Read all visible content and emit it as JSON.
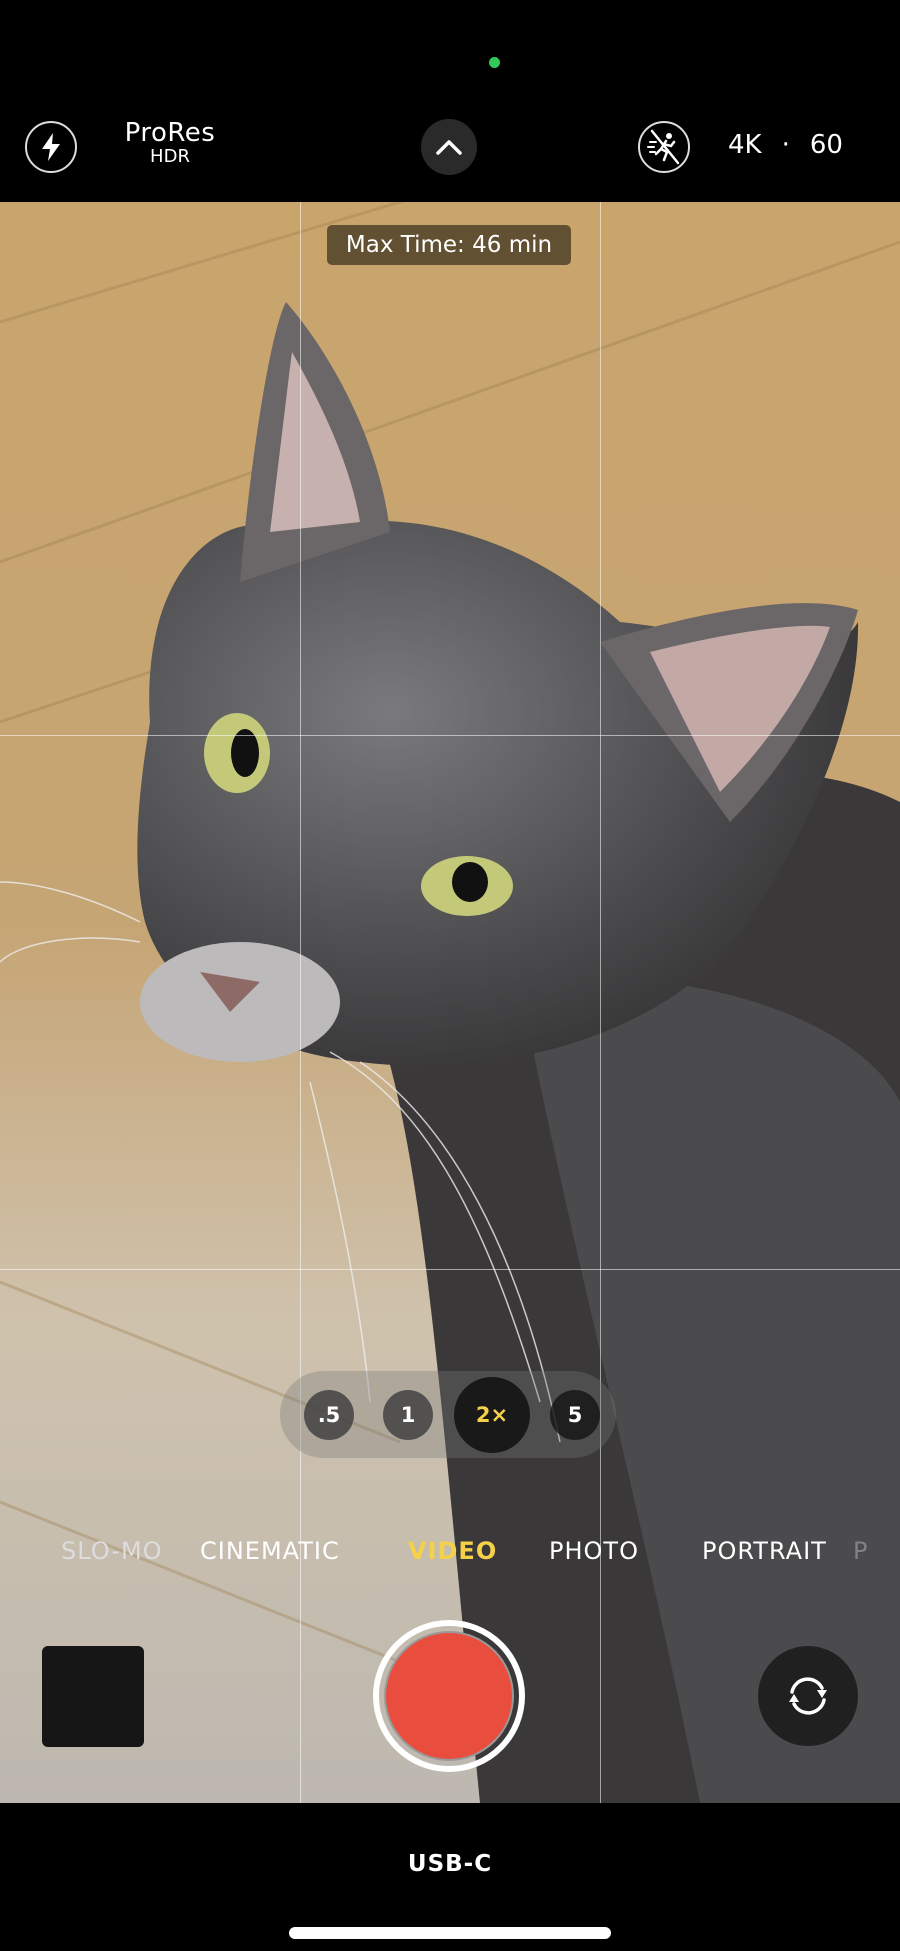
{
  "status": {
    "camera_indicator_color": "#34c759"
  },
  "topbar": {
    "flash_icon": "bolt-circle-icon",
    "format_label": "ProRes",
    "format_sub": "HDR",
    "expand_icon": "chevron-up-icon",
    "action_mode_icon": "action-mode-off-icon",
    "resolution": "4K",
    "separator": "·",
    "framerate": "60"
  },
  "viewfinder": {
    "max_time": "Max Time: 46 min",
    "zoom_levels": [
      ".5",
      "1",
      "2×",
      "5"
    ],
    "selected_zoom": "2×",
    "accent_color": "#f5d14a"
  },
  "modes": {
    "items": [
      "SLO-MO",
      "CINEMATIC",
      "VIDEO",
      "PHOTO",
      "PORTRAIT",
      "P"
    ],
    "selected": "VIDEO"
  },
  "controls": {
    "record_color": "#e84d3d",
    "flip_icon": "camera-rotate-icon"
  },
  "bottombar": {
    "label": "USB-C"
  }
}
